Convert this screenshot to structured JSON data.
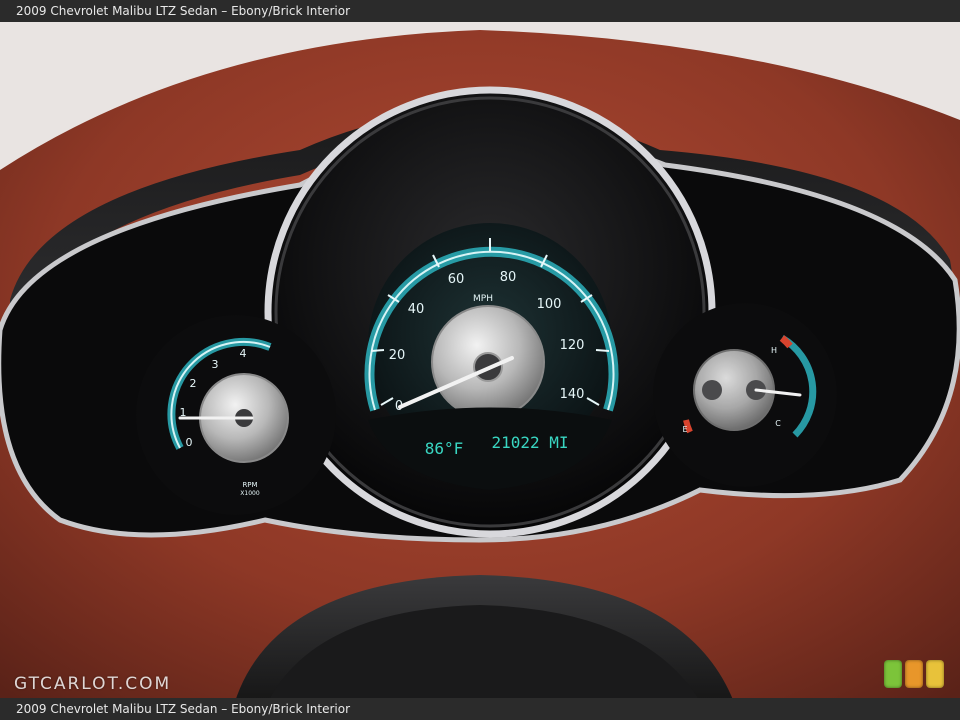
{
  "caption": {
    "top": "2009 Chevrolet Malibu LTZ Sedan – Ebony/Brick Interior",
    "bottom": "2009 Chevrolet Malibu LTZ Sedan – Ebony/Brick Interior"
  },
  "watermark": "GTCARLOT.COM",
  "speedometer": {
    "unit": "MPH",
    "labels": [
      "0",
      "20",
      "40",
      "60",
      "80",
      "100",
      "120",
      "140"
    ],
    "readout_temp": "86°F",
    "readout_odometer": "21022 MI"
  },
  "tachometer": {
    "labels": [
      "0",
      "1",
      "2",
      "3",
      "4"
    ],
    "unit_line1": "RPM",
    "unit_line2": "X1000"
  },
  "temp_gauge": {
    "hot_label": "H",
    "cold_label": "C"
  },
  "fuel_gauge": {
    "empty_label": "E"
  },
  "colors": {
    "dash": "#8a3a2a",
    "gauge_accent": "#2aa8b4",
    "light_green": "#7cc43a",
    "light_orange": "#e8962a",
    "light_yellow": "#e8c23a"
  }
}
